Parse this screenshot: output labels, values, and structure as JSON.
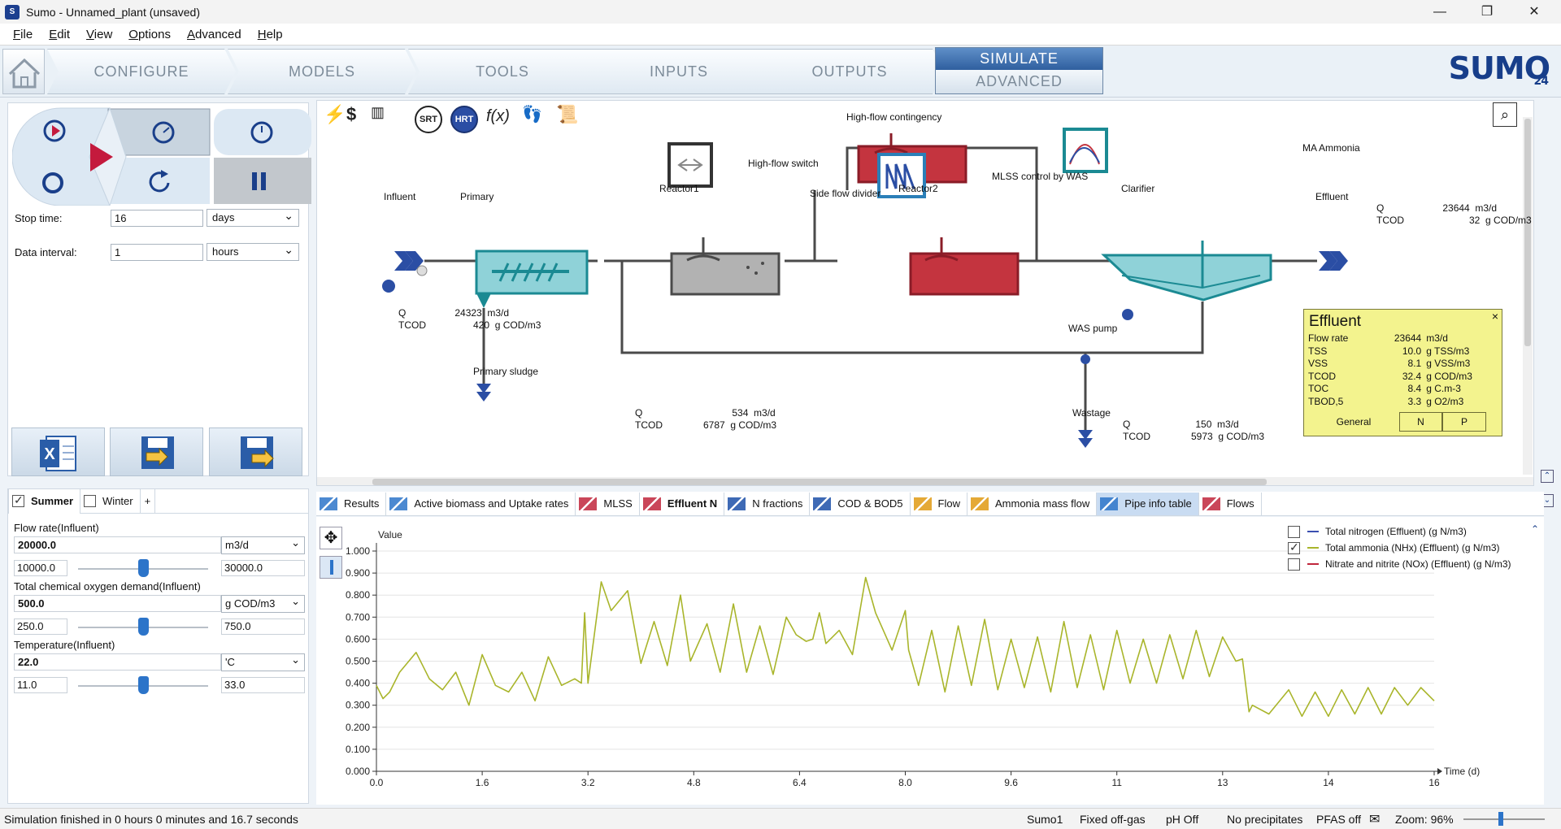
{
  "window": {
    "title": "Sumo - Unnamed_plant (unsaved)"
  },
  "menu": [
    "File",
    "Edit",
    "View",
    "Options",
    "Advanced",
    "Help"
  ],
  "ribbon": {
    "tabs": [
      "CONFIGURE",
      "MODELS",
      "TOOLS",
      "INPUTS",
      "OUTPUTS"
    ],
    "simulate_top": "SIMULATE",
    "simulate_bottom": "ADVANCED",
    "logo": "SUMO",
    "logo_version": "24"
  },
  "simulation": {
    "stop_time_label": "Stop time:",
    "stop_time_value": "16",
    "stop_time_unit": "days",
    "data_interval_label": "Data interval:",
    "data_interval_value": "1",
    "data_interval_unit": "hours"
  },
  "scenarios": {
    "active": "Summer",
    "other": "Winter",
    "add": "+"
  },
  "params": [
    {
      "label": "Flow rate(Influent)",
      "value": "20000.0",
      "unit": "m3/d",
      "min": "10000.0",
      "max": "30000.0",
      "level": 0.5
    },
    {
      "label": "Total chemical oxygen demand(Influent)",
      "value": "500.0",
      "unit": "g COD/m3",
      "min": "250.0",
      "max": "750.0",
      "level": 0.5
    },
    {
      "label": "Temperature(Influent)",
      "value": "22.0",
      "unit": "'C",
      "min": "11.0",
      "max": "33.0",
      "level": 0.5
    }
  ],
  "flowsheet": {
    "labels": {
      "influent": "Influent",
      "primary": "Primary",
      "reactor1": "Reactor1",
      "reactor2": "Reactor2",
      "clarifier": "Clarifier",
      "effluent": "Effluent",
      "high_flow_switch": "High-flow switch",
      "high_flow_contingency": "High-flow contingency",
      "side_flow_divider": "Side flow divider",
      "mlss_control": "MLSS control by WAS",
      "ma_ammonia": "MA Ammonia",
      "primary_sludge": "Primary sludge",
      "was_pump": "WAS pump",
      "wastage": "Wastage"
    },
    "toolbar": {
      "srt": "SRT",
      "hrt": "HRT",
      "fx": "f(x)"
    },
    "streams": {
      "influent": {
        "q_label": "Q",
        "q": "24323",
        "q_unit": "m3/d",
        "tcod_label": "TCOD",
        "tcod": "420",
        "tcod_unit": "g COD/m3"
      },
      "effluent": {
        "q_label": "Q",
        "q": "23644",
        "q_unit": "m3/d",
        "tcod_label": "TCOD",
        "tcod": "32",
        "tcod_unit": "g COD/m3"
      },
      "primary_sludge": {
        "q_label": "Q",
        "q": "534",
        "q_unit": "m3/d",
        "tcod_label": "TCOD",
        "tcod": "6787",
        "tcod_unit": "g COD/m3"
      },
      "wastage": {
        "q_label": "Q",
        "q": "150",
        "q_unit": "m3/d",
        "tcod_label": "TCOD",
        "tcod": "5973",
        "tcod_unit": "g COD/m3"
      }
    },
    "effluent_box": {
      "title": "Effluent",
      "close": "×",
      "rows": [
        {
          "label": "Flow rate",
          "value": "23644",
          "unit": "m3/d"
        },
        {
          "label": "TSS",
          "value": "10.0",
          "unit": "g TSS/m3"
        },
        {
          "label": "VSS",
          "value": "8.1",
          "unit": "g VSS/m3"
        },
        {
          "label": "TCOD",
          "value": "32.4",
          "unit": "g COD/m3"
        },
        {
          "label": "TOC",
          "value": "8.4",
          "unit": "g C.m-3"
        },
        {
          "label": "TBOD,5",
          "value": "3.3",
          "unit": "g O2/m3"
        }
      ],
      "tabs": [
        "General",
        "N",
        "P"
      ]
    }
  },
  "output_tabs": [
    {
      "label": "Results",
      "icon": "table-icon"
    },
    {
      "label": "Active biomass and Uptake rates",
      "icon": "table-icon"
    },
    {
      "label": "MLSS",
      "icon": "line-chart-icon"
    },
    {
      "label": "Effluent N",
      "icon": "line-chart-icon"
    },
    {
      "label": "N fractions",
      "icon": "pie-chart-icon"
    },
    {
      "label": "COD & BOD5",
      "icon": "bar-chart-icon"
    },
    {
      "label": "Flow",
      "icon": "sankey-icon"
    },
    {
      "label": "Ammonia mass flow",
      "icon": "sankey-icon"
    },
    {
      "label": "Pipe info table",
      "icon": "table-icon"
    },
    {
      "label": "Flows",
      "icon": "line-chart-icon"
    }
  ],
  "colors": {
    "accent": "#2c74c9",
    "ammonia": "#a9b52b",
    "total_n": "#3b4fb0",
    "nox": "#c0263c",
    "effluent_box": "#f3f38e"
  },
  "chart_data": {
    "type": "line",
    "ylabel": "Value",
    "xlabel": "Time  (d)",
    "xlim": [
      0,
      16
    ],
    "ylim": [
      0,
      1
    ],
    "x_ticks": [
      "0.0",
      "1.6",
      "3.2",
      "4.8",
      "6.4",
      "8.0",
      "9.6",
      "11",
      "13",
      "14",
      "16"
    ],
    "x_tick_values": [
      0,
      1.6,
      3.2,
      4.8,
      6.4,
      8.0,
      9.6,
      11.2,
      12.8,
      14.4,
      16
    ],
    "y_ticks": [
      "0.000",
      "0.100",
      "0.200",
      "0.300",
      "0.400",
      "0.500",
      "0.600",
      "0.700",
      "0.800",
      "0.900",
      "1.000"
    ],
    "legend": [
      {
        "name": "Total nitrogen (Effluent) (g N/m3)",
        "checked": false,
        "color": "#3b4fb0"
      },
      {
        "name": "Total ammonia (NHx) (Effluent) (g N/m3)",
        "checked": true,
        "color": "#a9b52b"
      },
      {
        "name": "Nitrate and nitrite (NOx) (Effluent) (g N/m3)",
        "checked": false,
        "color": "#c0263c"
      }
    ],
    "series": [
      {
        "name": "Total ammonia (NHx) (Effluent) (g N/m3)",
        "x": [
          0.0,
          0.1,
          0.2,
          0.35,
          0.6,
          0.8,
          1.0,
          1.2,
          1.4,
          1.6,
          1.8,
          2.0,
          2.2,
          2.4,
          2.6,
          2.8,
          3.0,
          3.1,
          3.15,
          3.2,
          3.4,
          3.55,
          3.8,
          4.0,
          4.2,
          4.4,
          4.6,
          4.75,
          5.0,
          5.2,
          5.4,
          5.6,
          5.8,
          6.0,
          6.2,
          6.35,
          6.5,
          6.6,
          6.7,
          6.8,
          7.0,
          7.2,
          7.4,
          7.55,
          7.8,
          8.0,
          8.05,
          8.2,
          8.4,
          8.6,
          8.8,
          9.0,
          9.2,
          9.4,
          9.6,
          9.8,
          10.0,
          10.2,
          10.4,
          10.6,
          10.8,
          11.0,
          11.2,
          11.4,
          11.6,
          11.8,
          12.0,
          12.2,
          12.4,
          12.6,
          12.8,
          13.0,
          13.1,
          13.2,
          13.25,
          13.5,
          13.8,
          14.0,
          14.2,
          14.4,
          14.6,
          14.8,
          15.0,
          15.2,
          15.4,
          15.6,
          15.8,
          16.0
        ],
        "values": [
          0.39,
          0.33,
          0.36,
          0.45,
          0.54,
          0.42,
          0.37,
          0.45,
          0.3,
          0.53,
          0.39,
          0.36,
          0.45,
          0.32,
          0.52,
          0.39,
          0.42,
          0.4,
          0.72,
          0.4,
          0.86,
          0.73,
          0.82,
          0.49,
          0.68,
          0.48,
          0.8,
          0.5,
          0.67,
          0.45,
          0.76,
          0.45,
          0.66,
          0.44,
          0.7,
          0.62,
          0.59,
          0.6,
          0.72,
          0.58,
          0.64,
          0.53,
          0.88,
          0.72,
          0.55,
          0.73,
          0.55,
          0.39,
          0.64,
          0.36,
          0.66,
          0.39,
          0.69,
          0.37,
          0.6,
          0.38,
          0.61,
          0.36,
          0.68,
          0.38,
          0.62,
          0.37,
          0.64,
          0.4,
          0.6,
          0.4,
          0.62,
          0.42,
          0.64,
          0.43,
          0.61,
          0.5,
          0.51,
          0.27,
          0.3,
          0.26,
          0.37,
          0.25,
          0.36,
          0.25,
          0.37,
          0.26,
          0.38,
          0.26,
          0.38,
          0.3,
          0.38,
          0.32
        ]
      }
    ]
  },
  "status": {
    "message": "Simulation finished in 0 hours 0 minutes and 16.7 seconds",
    "model": "Sumo1",
    "offgas": "Fixed off-gas",
    "ph": "pH Off",
    "precip": "No precipitates",
    "pfas": "PFAS off",
    "zoom": "Zoom: 96%"
  }
}
